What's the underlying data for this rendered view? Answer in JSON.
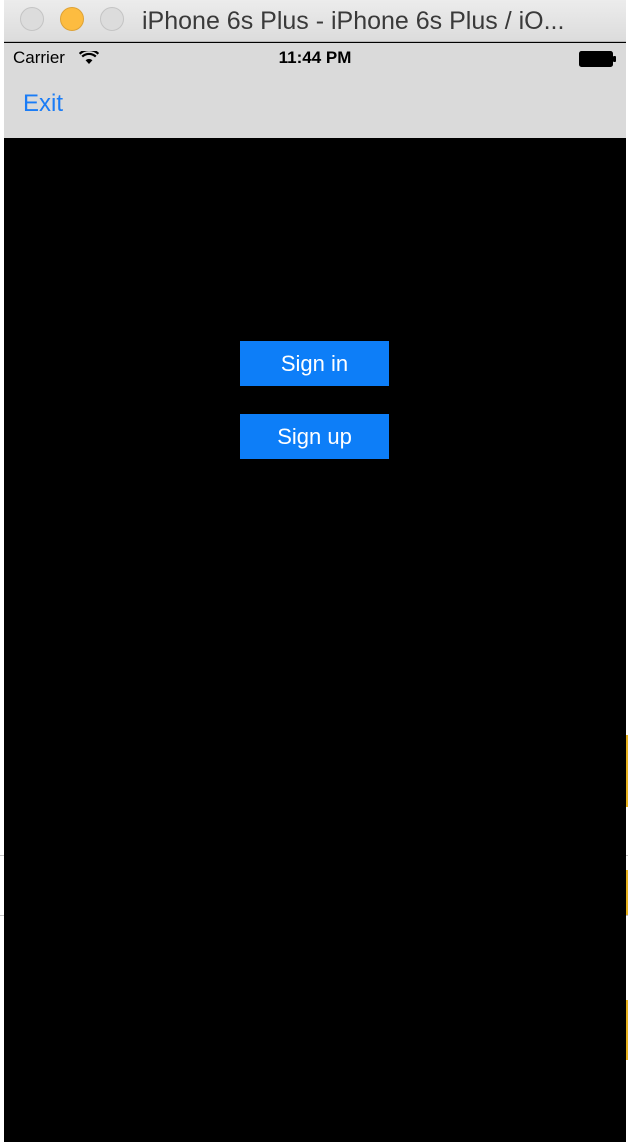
{
  "window": {
    "title": "iPhone 6s Plus - iPhone 6s Plus / iO..."
  },
  "status_bar": {
    "carrier": "Carrier",
    "time": "11:44 PM",
    "icons": [
      "wifi-icon",
      "battery-icon"
    ]
  },
  "nav_bar": {
    "exit_label": "Exit"
  },
  "main": {
    "sign_in_label": "Sign in",
    "sign_up_label": "Sign up"
  },
  "colors": {
    "accent": "#0d7ef8",
    "link": "#1a7cf6",
    "content_background": "#000000",
    "bar_background": "#dadada"
  }
}
